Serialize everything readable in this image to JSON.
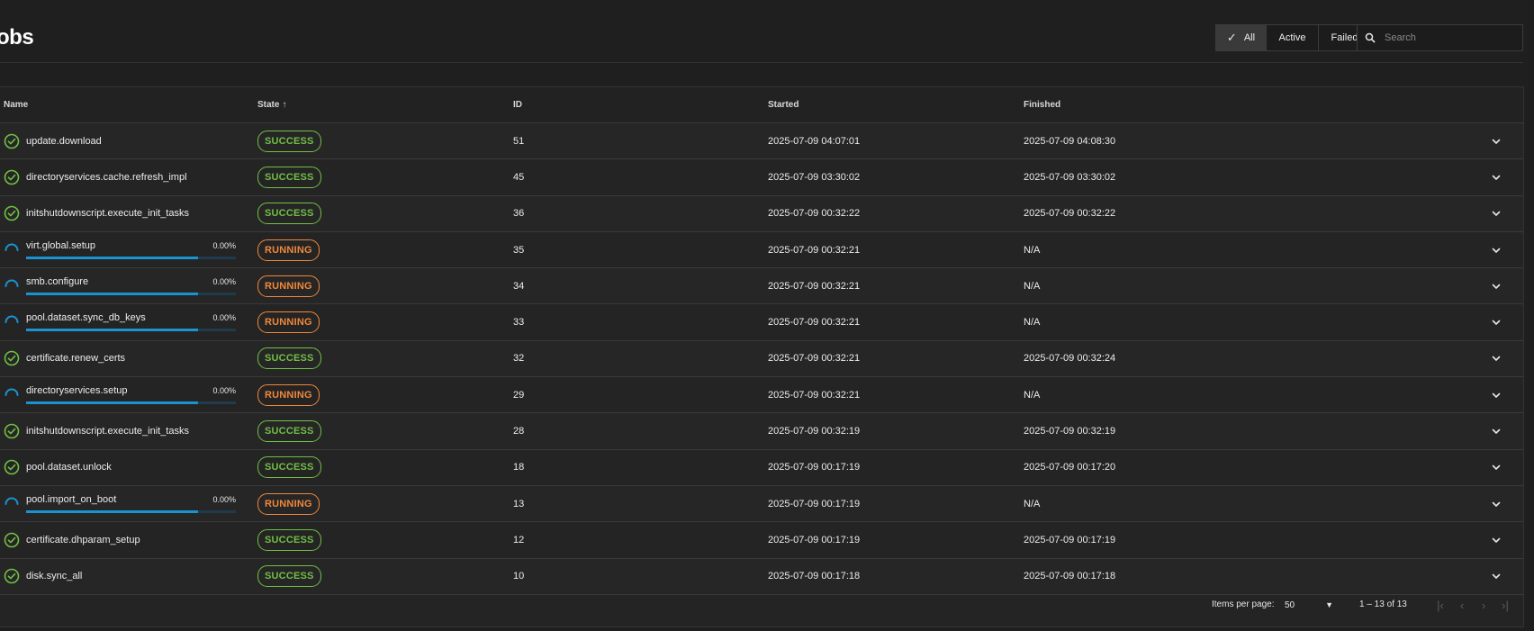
{
  "page": {
    "title": "obs"
  },
  "filters": {
    "all": "All",
    "active": "Active",
    "failed": "Failed"
  },
  "search": {
    "placeholder": "Search",
    "value": ""
  },
  "table": {
    "headers": {
      "name": "Name",
      "state": "State",
      "id": "ID",
      "started": "Started",
      "finished": "Finished"
    },
    "sort_indicator": "↑",
    "rows": [
      {
        "name": "update.download",
        "status": "success",
        "state": "SUCCESS",
        "id": "51",
        "started": "2025-07-09 04:07:01",
        "finished": "2025-07-09 04:08:30"
      },
      {
        "name": "directoryservices.cache.refresh_impl",
        "status": "success",
        "state": "SUCCESS",
        "id": "45",
        "started": "2025-07-09 03:30:02",
        "finished": "2025-07-09 03:30:02"
      },
      {
        "name": "initshutdownscript.execute_init_tasks",
        "status": "success",
        "state": "SUCCESS",
        "id": "36",
        "started": "2025-07-09 00:32:22",
        "finished": "2025-07-09 00:32:22"
      },
      {
        "name": "virt.global.setup",
        "status": "running",
        "state": "RUNNING",
        "progress": "0.00%",
        "id": "35",
        "started": "2025-07-09 00:32:21",
        "finished": "N/A"
      },
      {
        "name": "smb.configure",
        "status": "running",
        "state": "RUNNING",
        "progress": "0.00%",
        "id": "34",
        "started": "2025-07-09 00:32:21",
        "finished": "N/A"
      },
      {
        "name": "pool.dataset.sync_db_keys",
        "status": "running",
        "state": "RUNNING",
        "progress": "0.00%",
        "id": "33",
        "started": "2025-07-09 00:32:21",
        "finished": "N/A"
      },
      {
        "name": "certificate.renew_certs",
        "status": "success",
        "state": "SUCCESS",
        "id": "32",
        "started": "2025-07-09 00:32:21",
        "finished": "2025-07-09 00:32:24"
      },
      {
        "name": "directoryservices.setup",
        "status": "running",
        "state": "RUNNING",
        "progress": "0.00%",
        "id": "29",
        "started": "2025-07-09 00:32:21",
        "finished": "N/A"
      },
      {
        "name": "initshutdownscript.execute_init_tasks",
        "status": "success",
        "state": "SUCCESS",
        "id": "28",
        "started": "2025-07-09 00:32:19",
        "finished": "2025-07-09 00:32:19"
      },
      {
        "name": "pool.dataset.unlock",
        "status": "success",
        "state": "SUCCESS",
        "id": "18",
        "started": "2025-07-09 00:17:19",
        "finished": "2025-07-09 00:17:20"
      },
      {
        "name": "pool.import_on_boot",
        "status": "running",
        "state": "RUNNING",
        "progress": "0.00%",
        "id": "13",
        "started": "2025-07-09 00:17:19",
        "finished": "N/A"
      },
      {
        "name": "certificate.dhparam_setup",
        "status": "success",
        "state": "SUCCESS",
        "id": "12",
        "started": "2025-07-09 00:17:19",
        "finished": "2025-07-09 00:17:19"
      },
      {
        "name": "disk.sync_all",
        "status": "success",
        "state": "SUCCESS",
        "id": "10",
        "started": "2025-07-09 00:17:18",
        "finished": "2025-07-09 00:17:18"
      }
    ]
  },
  "paginator": {
    "items_per_page_label": "Items per page:",
    "items_per_page": "50",
    "range": "1 – 13 of 13"
  },
  "colors": {
    "success": "#71bf44",
    "running": "#f0883a",
    "progress": "#1a93d0",
    "background": "#1f1f1f"
  },
  "icons": {
    "success": "check-circle-icon",
    "running": "spinner-icon",
    "expand": "chevron-down-icon",
    "search": "search-icon",
    "first": "first-page-icon",
    "prev": "prev-page-icon",
    "next": "next-page-icon",
    "last": "last-page-icon"
  }
}
